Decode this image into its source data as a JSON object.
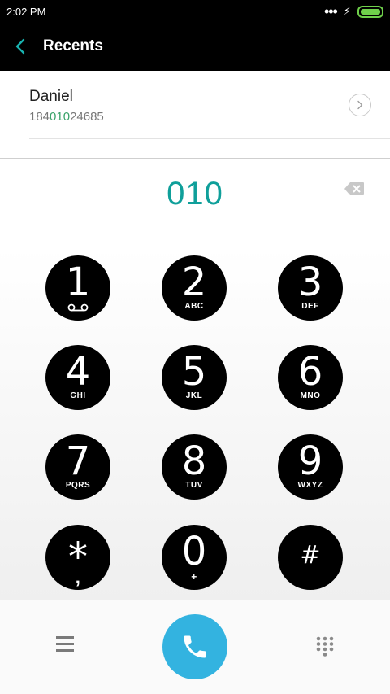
{
  "status_bar": {
    "time": "2:02 PM",
    "dots": "•••",
    "bolt": "⚡"
  },
  "header": {
    "title": "Recents"
  },
  "result": {
    "name": "Daniel",
    "number_prefix": "184",
    "number_match": "010",
    "number_suffix": "24685"
  },
  "dial_entry": {
    "value": "010"
  },
  "keypad": {
    "keys": [
      {
        "digit": "1",
        "letters": ""
      },
      {
        "digit": "2",
        "letters": "ABC"
      },
      {
        "digit": "3",
        "letters": "DEF"
      },
      {
        "digit": "4",
        "letters": "GHI"
      },
      {
        "digit": "5",
        "letters": "JKL"
      },
      {
        "digit": "6",
        "letters": "MNO"
      },
      {
        "digit": "7",
        "letters": "PQRS"
      },
      {
        "digit": "8",
        "letters": "TUV"
      },
      {
        "digit": "9",
        "letters": "WXYZ"
      },
      {
        "digit": "*",
        "letters": ","
      },
      {
        "digit": "0",
        "letters": "+"
      },
      {
        "digit": "#",
        "letters": ""
      }
    ]
  },
  "icons": {
    "back": "chevron-left-icon",
    "detail": "chevron-right-icon",
    "backspace": "backspace-icon",
    "voicemail": "voicemail-icon",
    "menu": "menu-icon",
    "call": "phone-icon",
    "dialpad": "dialpad-icon"
  },
  "colors": {
    "accent_teal": "#0f9f9a",
    "match_green": "#3aa36a",
    "call_blue": "#33b3e0",
    "battery_green": "#6fd04b"
  }
}
